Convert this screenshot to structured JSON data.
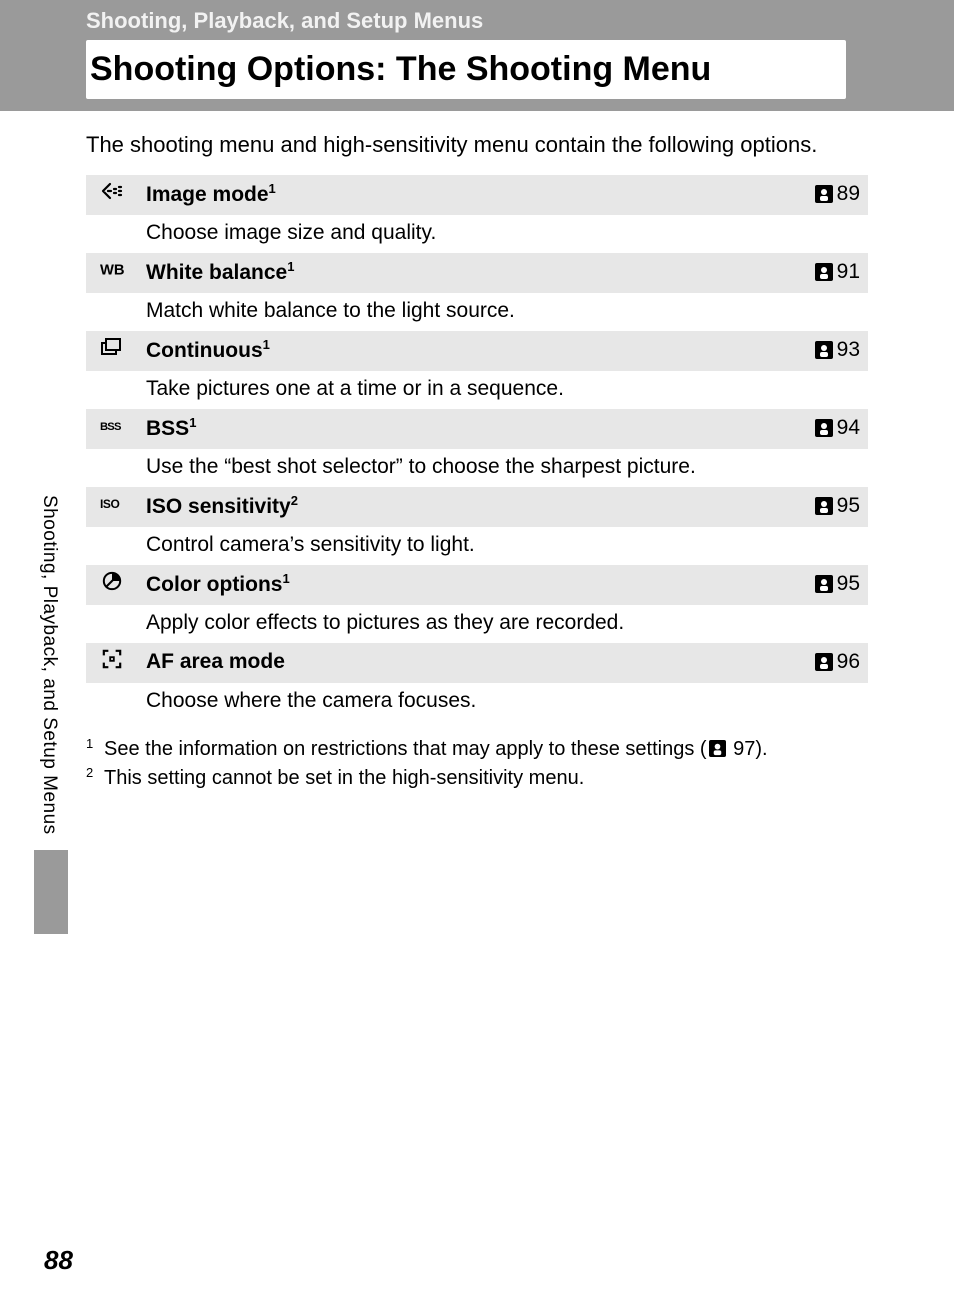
{
  "breadcrumb": "Shooting, Playback, and Setup Menus",
  "title": "Shooting Options: The Shooting Menu",
  "intro": "The shooting menu and high-sensitivity menu contain the following options.",
  "options": [
    {
      "icon": "image-mode-icon",
      "label": "Image mode",
      "sup": "1",
      "page": "89",
      "desc": "Choose image size and quality."
    },
    {
      "icon": "wb-icon",
      "label": "White balance",
      "sup": "1",
      "page": "91",
      "desc": "Match white balance to the light source."
    },
    {
      "icon": "continuous-icon",
      "label": "Continuous",
      "sup": "1",
      "page": "93",
      "desc": "Take pictures one at a time or in a sequence."
    },
    {
      "icon": "bss-icon",
      "label": "BSS",
      "sup": "1",
      "page": "94",
      "desc": "Use the “best shot selector” to choose the sharpest picture."
    },
    {
      "icon": "iso-icon",
      "label": "ISO sensitivity",
      "sup": "2",
      "page": "95",
      "desc": "Control camera’s sensitivity to light."
    },
    {
      "icon": "color-options-icon",
      "label": "Color options",
      "sup": "1",
      "page": "95",
      "desc": "Apply color effects to pictures as they are recorded."
    },
    {
      "icon": "af-area-icon",
      "label": "AF area mode",
      "sup": "",
      "page": "96",
      "desc": "Choose where the camera focuses."
    }
  ],
  "footnotes": {
    "f1_num": "1",
    "f1_a": "See the information on restrictions that may apply to these settings (",
    "f1_b": " 97).",
    "f2_num": "2",
    "f2": "This setting cannot be set in the high-sensitivity menu."
  },
  "side_tab": "Shooting, Playback, and Setup Menus",
  "page_number": "88"
}
